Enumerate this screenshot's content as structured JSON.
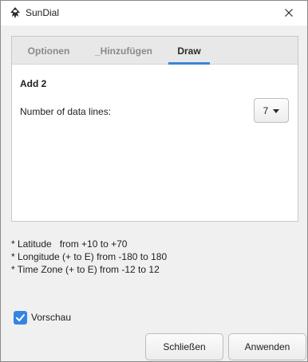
{
  "window": {
    "title": "SunDial",
    "close_icon": "close-icon"
  },
  "tabs": [
    {
      "label": "Optionen",
      "active": false
    },
    {
      "label": "_Hinzufügen",
      "active": false
    },
    {
      "label": "Draw",
      "active": true
    }
  ],
  "draw": {
    "section_title": "Add 2",
    "data_lines_label": "Number of data lines:",
    "data_lines_value": "7"
  },
  "help": {
    "lines": [
      "* Latitude   from +10 to +70",
      "* Longitude (+ to E) from -180 to 180",
      "* Time Zone (+ to E) from -12 to 12"
    ]
  },
  "preview": {
    "label": "Vorschau",
    "checked": true
  },
  "buttons": {
    "close_label": "Schließen",
    "apply_label": "Anwenden"
  },
  "colors": {
    "accent": "#3584e4",
    "tab_underline": "#3b86d6"
  }
}
